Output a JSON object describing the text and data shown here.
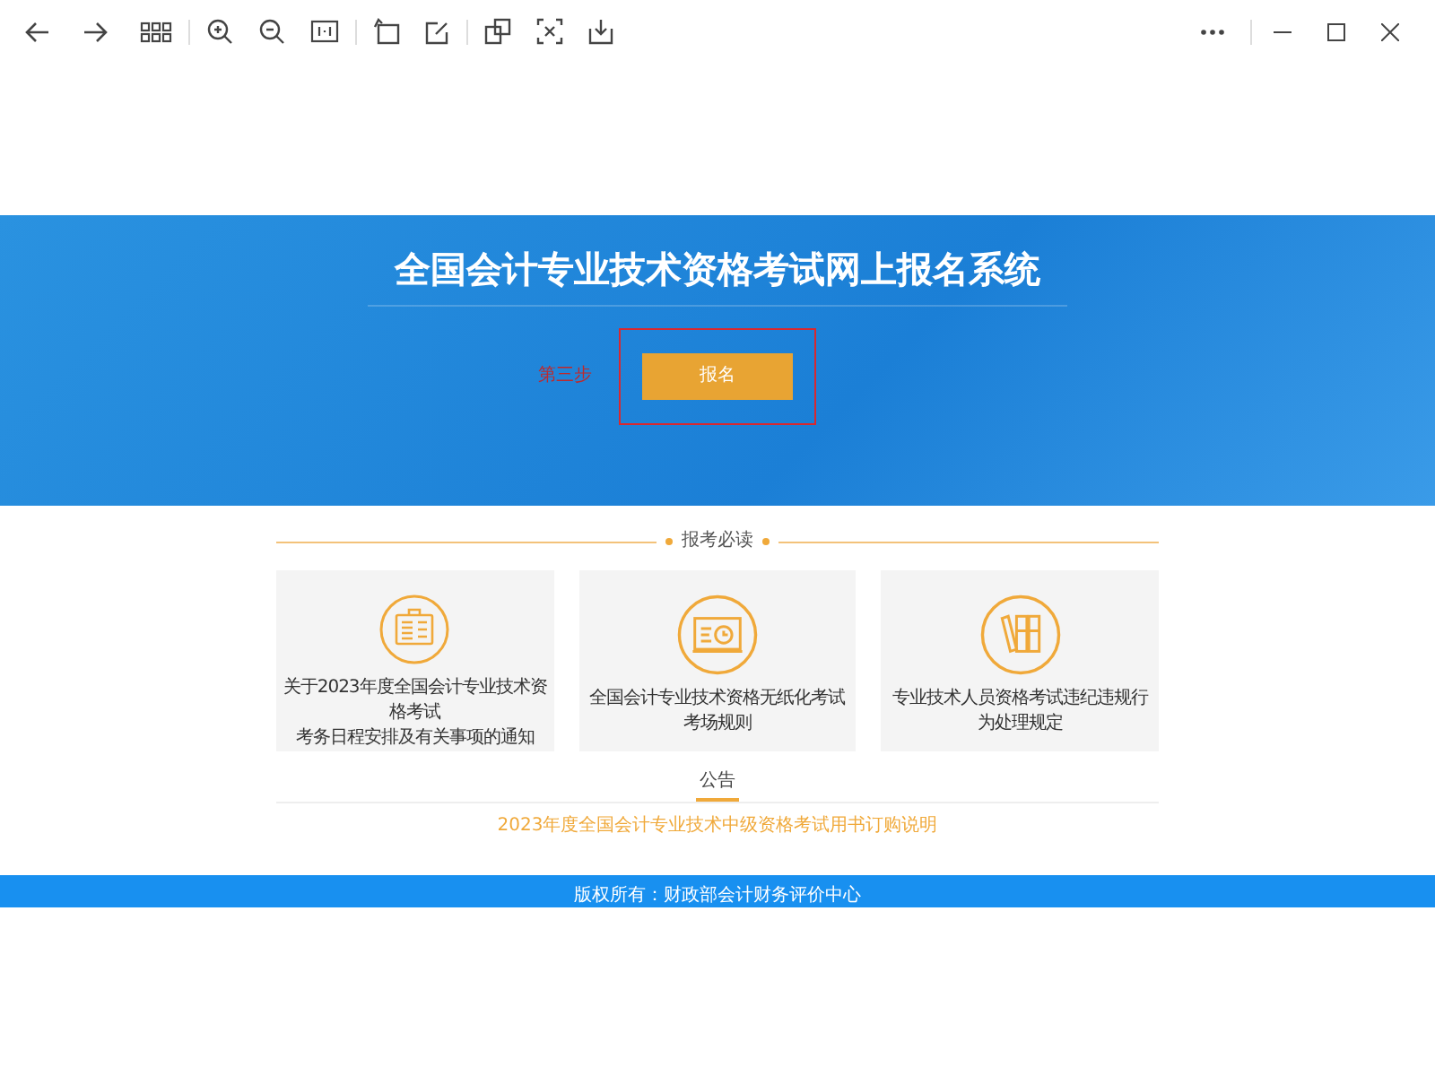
{
  "banner": {
    "title": "全国会计专业技术资格考试网上报名系统",
    "step_label": "第三步",
    "register_button": "报名"
  },
  "must_read": {
    "heading": "报考必读",
    "cards": [
      {
        "kind": "calendar",
        "lines": [
          "关于2023年度全国会计专业技术资格考试",
          "考务日程安排及有关事项的通知"
        ]
      },
      {
        "kind": "monitor",
        "lines": [
          "全国会计专业技术资格无纸化考试考场规则"
        ]
      },
      {
        "kind": "books",
        "lines": [
          "专业技术人员资格考试违纪违规行为处理规定"
        ]
      }
    ]
  },
  "notice": {
    "heading": "公告",
    "items": [
      "2023年度全国会计专业技术中级资格考试用书订购说明"
    ]
  },
  "footer": {
    "text": "版权所有：财政部会计财务评价中心"
  }
}
